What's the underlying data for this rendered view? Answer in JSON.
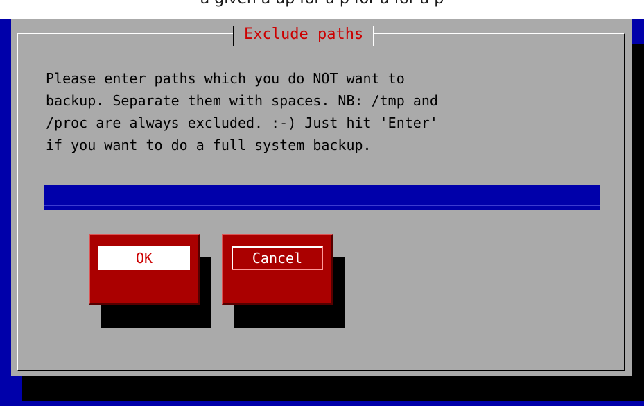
{
  "top_strip": {
    "text": "a given a up for a p for a for a p"
  },
  "dialog": {
    "title": "Exclude paths",
    "message": "Please enter paths which you do NOT want to\nbackup. Separate them with spaces. NB: /tmp and\n/proc are always excluded. :-) Just hit 'Enter'\nif you want to do a full system backup.",
    "input": {
      "value": ""
    },
    "buttons": {
      "ok_label": "OK",
      "cancel_label": "Cancel",
      "selected": "OK"
    }
  },
  "colors": {
    "background": "#0000aa",
    "dialog": "#aaaaaa",
    "title": "#cc0000",
    "button": "#aa0000",
    "input": "#0000aa"
  }
}
